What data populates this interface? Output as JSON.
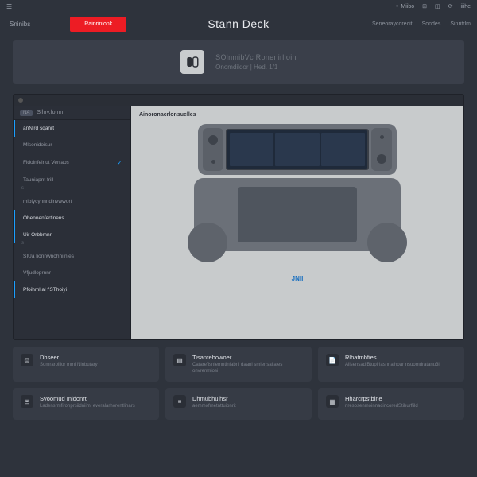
{
  "topbar": {
    "right": [
      "✦ Miibo",
      "⊞",
      "◫",
      "⟳",
      "iiihe"
    ]
  },
  "header": {
    "nav_tab": "Sninibs",
    "cta": "Rainrinionk",
    "title": "Stann Deck",
    "right": [
      "Seneoraycorecit",
      "Sondes",
      "Sinritrlm"
    ]
  },
  "banner": {
    "line1": "SOlnmibVc Ronenirlloin",
    "line2": "Onomdildor | Hed. 1/1"
  },
  "sidebar": {
    "header_badge": "NA",
    "header_text": "Slhrv.fomn",
    "items": [
      {
        "label": "anNird sqanrt",
        "active": true,
        "check": false
      },
      {
        "label": "Mlsonidoisur",
        "active": false,
        "check": false
      },
      {
        "label": "Fldoinfelnut Verraos",
        "active": false,
        "check": true
      },
      {
        "label": "Tauniapnt frill",
        "active": false,
        "check": false,
        "sub": "s"
      },
      {
        "label": "mlblycynnndinvwwort",
        "active": false,
        "check": false
      },
      {
        "label": "Ohennenfertinens",
        "active": true,
        "check": false
      },
      {
        "label": "Uir Orbbmnr",
        "active": true,
        "check": false,
        "sub": "s"
      },
      {
        "label": "SIUa lionnwnohhiinies",
        "active": false,
        "check": false
      },
      {
        "label": "Vfjudloprnnr",
        "active": false,
        "check": false
      },
      {
        "label": "Pfoihml.al f'SThoiyi",
        "active": true,
        "check": false
      }
    ],
    "bottom": [
      "⊙",
      "⊙"
    ]
  },
  "viewport": {
    "label": "Ainoronacrlonsuelles",
    "tag": "JNlI"
  },
  "cards_row1": [
    {
      "icon": "⛁",
      "title": "Dhseer",
      "sub": "Somrarolilor mmi Ninbutary"
    },
    {
      "icon": "▤",
      "title": "Tisanrehowoer",
      "sub": "Catarefisniemntinlabnl daani smiensaiiales onvrenmiosi"
    },
    {
      "icon": "📄",
      "title": "Rlhatmbfies",
      "sub": "AilsensadiBtupirlasnnalhoar nsuomdratanu3li"
    }
  ],
  "cards_row2": [
    {
      "icon": "⊟",
      "title": "Svoomud Inidonrt",
      "sub": "Ladensrmfirohprsiidniimi everalarhorentlinars"
    },
    {
      "icon": "≡",
      "title": "Dhmubhuihsr",
      "sub": "aemmofmetnttuibnrit"
    },
    {
      "icon": "▦",
      "title": "Hharcrpstbine",
      "sub": "nresosenmoinnacincoredStihurflild"
    }
  ]
}
